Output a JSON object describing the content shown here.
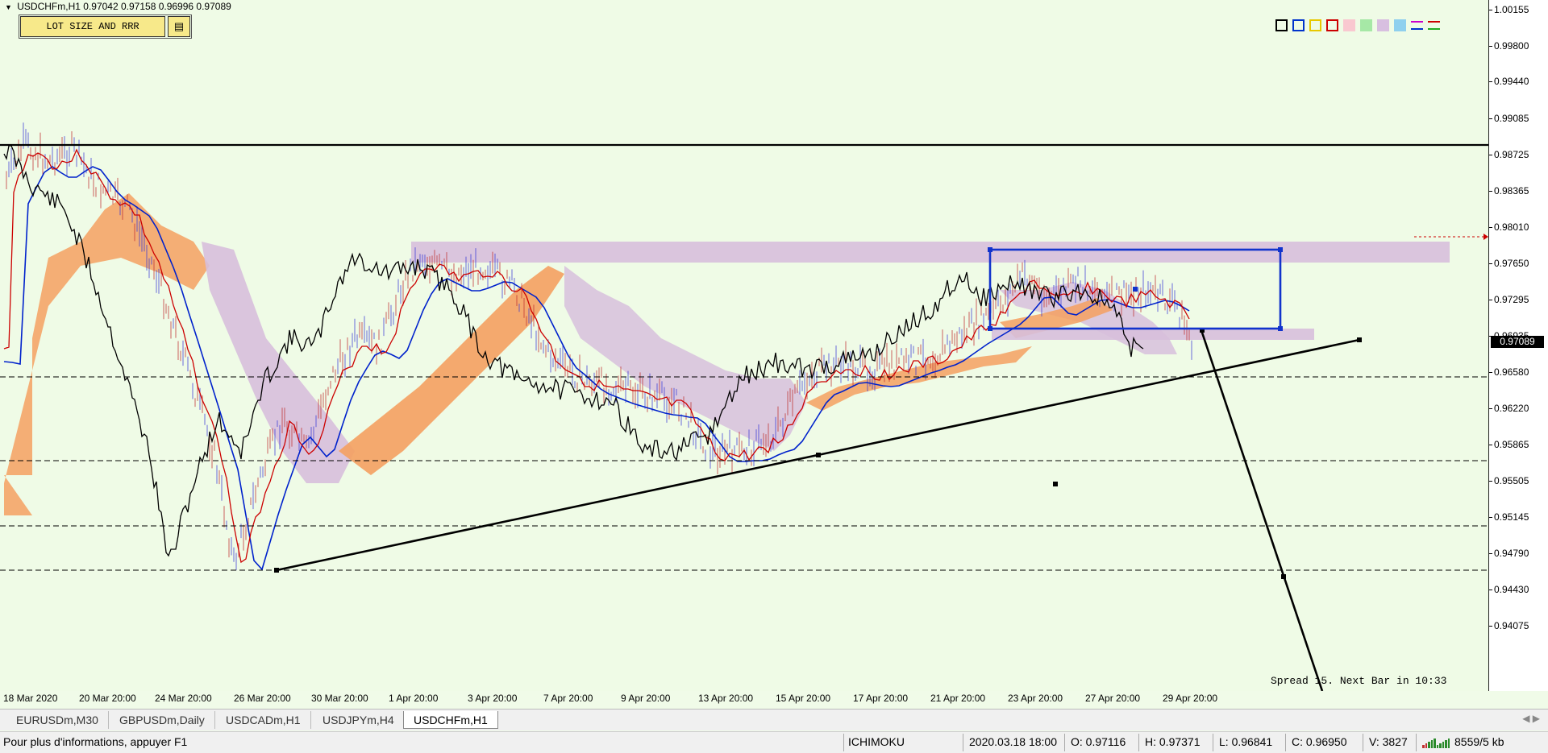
{
  "symbol_header": {
    "symbol": "USDCHFm,H1",
    "ohlc": "0.97042 0.97158 0.96996 0.97089"
  },
  "panel": {
    "button_label": "LOT SIZE AND RRR",
    "icon": "calculator-icon"
  },
  "palette": {
    "items": [
      {
        "name": "black-square-icon",
        "color": "#000000"
      },
      {
        "name": "blue-square-icon",
        "color": "#0033cc"
      },
      {
        "name": "yellow-square-icon",
        "color": "#e8c800"
      },
      {
        "name": "red-square-icon",
        "color": "#cc0000"
      },
      {
        "name": "pink-fill-icon",
        "color": "#f9c8d0"
      },
      {
        "name": "green-fill-icon",
        "color": "#a6e8a6"
      },
      {
        "name": "lilac-fill-icon",
        "color": "#d8bfe0"
      },
      {
        "name": "cyan-fill-icon",
        "color": "#8fd0ee"
      },
      {
        "name": "magenta-line-icon",
        "color": "#cc00cc"
      },
      {
        "name": "red-green-line-icon",
        "color": "#cc0000"
      }
    ]
  },
  "price_axis": {
    "labels": [
      "1.00155",
      "0.99800",
      "0.99440",
      "0.99085",
      "0.98725",
      "0.98365",
      "0.98010",
      "0.97650",
      "0.97295",
      "0.96935",
      "0.96580",
      "0.96220",
      "0.95865",
      "0.95505",
      "0.95145",
      "0.94790",
      "0.94430",
      "0.94075"
    ],
    "current_price": "0.97089"
  },
  "time_axis": {
    "labels": [
      "18 Mar 2020",
      "20 Mar 20:00",
      "24 Mar 20:00",
      "26 Mar 20:00",
      "30 Mar 20:00",
      "1 Apr 20:00",
      "3 Apr 20:00",
      "7 Apr 20:00",
      "9 Apr 20:00",
      "13 Apr 20:00",
      "15 Apr 20:00",
      "17 Apr 20:00",
      "21 Apr 20:00",
      "23 Apr 20:00",
      "27 Apr 20:00",
      "29 Apr 20:00"
    ]
  },
  "spread_info": "Spread  15. Next Bar in 10:33",
  "tabs": [
    {
      "label": "EURUSDm,M30",
      "active": false
    },
    {
      "label": "GBPUSDm,Daily",
      "active": false
    },
    {
      "label": "USDCADm,H1",
      "active": false
    },
    {
      "label": "USDJPYm,H4",
      "active": false
    },
    {
      "label": "USDCHFm,H1",
      "active": true
    }
  ],
  "status": {
    "help": "Pour plus d'informations, appuyer F1",
    "profile": "ICHIMOKU",
    "datetime": "2020.03.18 18:00",
    "open": "O: 0.97116",
    "high": "H: 0.97371",
    "low": "L: 0.96841",
    "close": "C: 0.96950",
    "volume": "V: 3827",
    "traffic": "8559/5 kb"
  },
  "colors": {
    "background": "#effbe6",
    "price_line": "#000000",
    "tenkan": "#cc0000",
    "kijun": "#0022cc",
    "kumo_bull": "#f4a060",
    "kumo_bear": "#d7bfdc",
    "zone": "#d7bfdc"
  }
}
